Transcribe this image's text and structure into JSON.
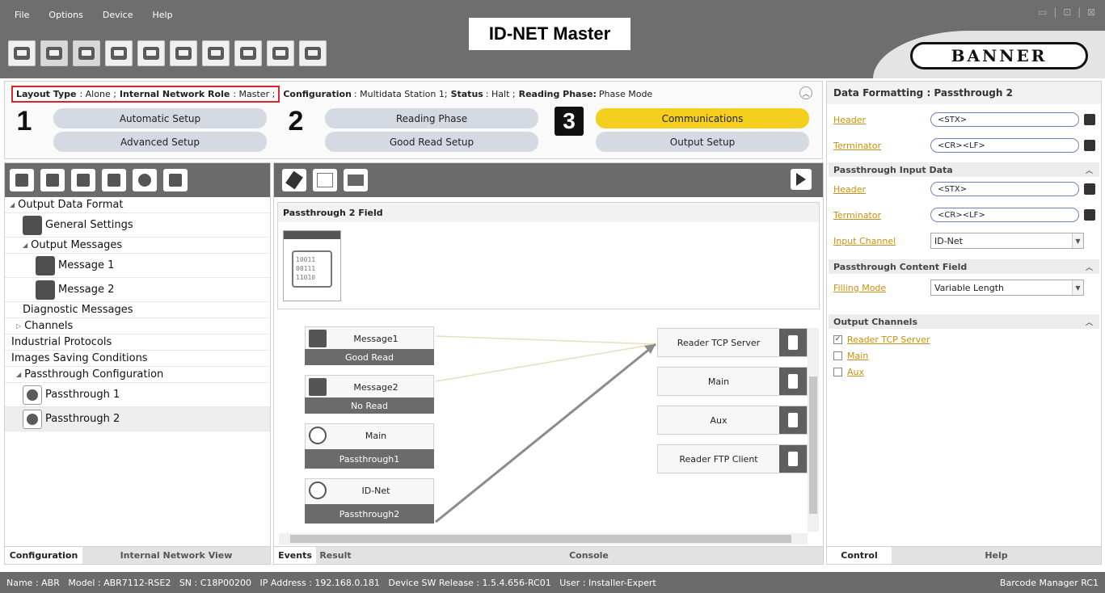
{
  "menu": [
    "File",
    "Options",
    "Device",
    "Help"
  ],
  "window_controls": "▭ | ⊡ | ⊠",
  "app_title": "ID-NET Master",
  "logo_text": "BANNER",
  "toolbar_icons": [
    "display-icon",
    "search-icon",
    "user-settings-icon",
    "panel-icon",
    "export-icon",
    "save-icon",
    "import-icon",
    "download-icon",
    "upload-icon",
    "network-icon"
  ],
  "status_line": {
    "layout_type_label": "Layout Type",
    "layout_type_value": ": Alone ;",
    "network_role_label": "Internal Network Role",
    "network_role_value": ": Master ;",
    "configuration_label": "Configuration",
    "configuration_value": ": Multidata Station 1;",
    "status_label": "Status",
    "status_value": ": Halt ;",
    "reading_phase_label": "Reading Phase:",
    "reading_phase_value": "Phase Mode"
  },
  "steps": [
    {
      "number": "1",
      "buttons": [
        "Automatic Setup",
        "Advanced Setup"
      ]
    },
    {
      "number": "2",
      "buttons": [
        "Reading Phase",
        "Good Read Setup"
      ]
    },
    {
      "number": "3",
      "buttons": [
        "Communications",
        "Output Setup"
      ]
    }
  ],
  "tree": {
    "output_data_format": "Output Data Format",
    "general_settings": "General Settings",
    "output_messages": "Output Messages",
    "message1": "Message 1",
    "message2": "Message 2",
    "diagnostic_messages": "Diagnostic Messages",
    "channels": "Channels",
    "industrial_protocols": "Industrial Protocols",
    "images_saving": "Images Saving Conditions",
    "passthrough_config": "Passthrough Configuration",
    "passthrough1": "Passthrough 1",
    "passthrough2": "Passthrough 2"
  },
  "left_tabs": [
    "Configuration",
    "Internal Network View"
  ],
  "field": {
    "title": "Passthrough 2 Field",
    "icon_text": "10011\n00111\n11010"
  },
  "flow": {
    "sources": [
      {
        "label": "Message1",
        "sub": "Good Read"
      },
      {
        "label": "Message2",
        "sub": "No Read"
      },
      {
        "label": "Main",
        "sub": "Passthrough1"
      },
      {
        "label": "ID-Net",
        "sub": "Passthrough2"
      }
    ],
    "destinations": [
      "Reader TCP Server",
      "Main",
      "Aux",
      "Reader FTP Client"
    ]
  },
  "center_tabs": [
    "Events",
    "Result",
    "Console"
  ],
  "right": {
    "title": "Data Formatting : Passthrough 2",
    "header_label": "Header",
    "header_value": "<STX>",
    "terminator_label": "Terminator",
    "terminator_value": "<CR><LF>",
    "input_section": "Passthrough Input Data",
    "input_header_label": "Header",
    "input_header_value": "<STX>",
    "input_terminator_label": "Terminator",
    "input_terminator_value": "<CR><LF>",
    "input_channel_label": "Input Channel",
    "input_channel_value": "ID-Net",
    "content_section": "Passthrough Content Field",
    "filling_mode_label": "Filling Mode",
    "filling_mode_value": "Variable Length",
    "output_section": "Output Channels",
    "output_channels": [
      {
        "label": "Reader TCP Server",
        "checked": true
      },
      {
        "label": "Main",
        "checked": false
      },
      {
        "label": "Aux",
        "checked": false
      }
    ]
  },
  "right_tabs": [
    "Control",
    "Help"
  ],
  "statusbar": {
    "left": "Name : ABR   Model : ABR7112-RSE2   SN : C18P00200   IP Address : 192.168.0.181   Device SW Release : 1.5.4.656-RC01   User : Installer-Expert",
    "right": "Barcode Manager RC1"
  },
  "colors": {
    "accent_yellow": "#f4cf1d",
    "dark_gray": "#6b6b6b",
    "highlight_red": "#d9232d",
    "link_orange": "#c8900e"
  }
}
